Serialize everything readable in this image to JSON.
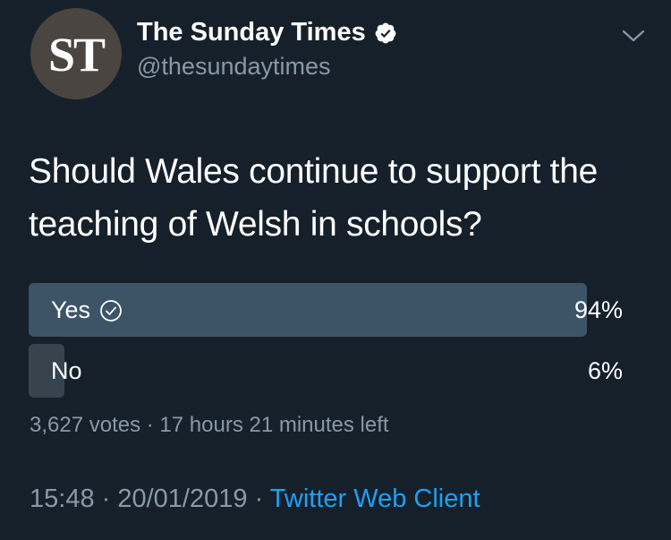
{
  "author": {
    "avatar_text": "ST",
    "display_name": "The Sunday Times",
    "handle": "@thesundaytimes",
    "verified": true
  },
  "tweet": {
    "text": "Should Wales continue to support the teaching of Welsh in schools?"
  },
  "poll": {
    "options": [
      {
        "label": "Yes",
        "percent_label": "94%",
        "percent": 94,
        "selected": true
      },
      {
        "label": "No",
        "percent_label": "6%",
        "percent": 6,
        "selected": false
      }
    ],
    "votes": "3,627 votes",
    "separator": " · ",
    "time_left": "17 hours 21 minutes left"
  },
  "footer": {
    "time": "15:48",
    "separator": " · ",
    "date": "20/01/2019",
    "client": "Twitter Web Client"
  },
  "colors": {
    "background": "#15202b",
    "secondary_text": "#8899a6",
    "link": "#1da1f2",
    "winning_bar": "#3d5466",
    "losing_bar": "#38444d"
  },
  "icons": {
    "verified": "verified-badge-icon",
    "menu": "chevron-down-icon",
    "selected": "check-circle-icon"
  }
}
